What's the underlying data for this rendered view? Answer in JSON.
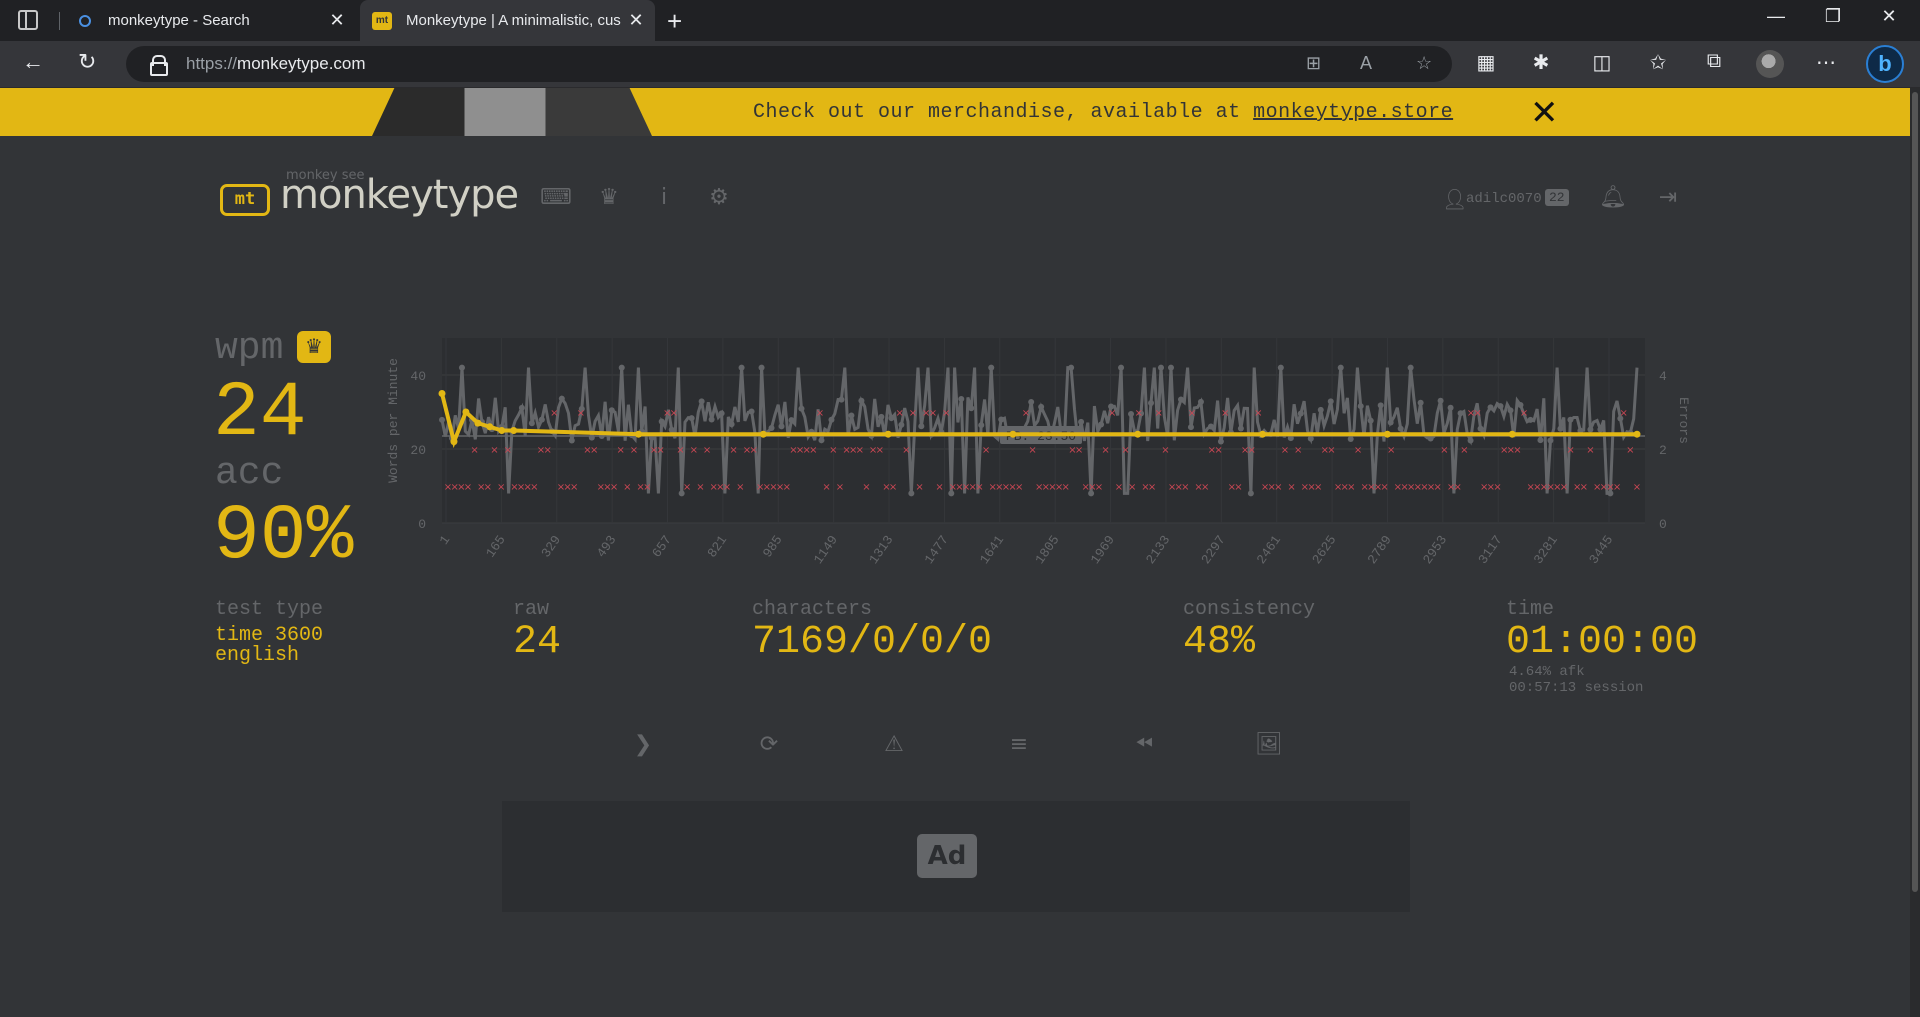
{
  "browser": {
    "tabs": [
      {
        "title": "monkeytype - Search",
        "icon": "search-icon"
      },
      {
        "title": "Monkeytype | A minimalistic, cus",
        "icon": "monkeytype-favicon"
      }
    ],
    "url_protocol": "https://",
    "url_host": "monkeytype.com"
  },
  "banner": {
    "text": "Check out our merchandise, available at ",
    "link": "monkeytype.store"
  },
  "header": {
    "logo_small": "monkey see",
    "logo_text": "monkeytype",
    "logo_icon": "mt",
    "username": "adilc0070",
    "level": "22"
  },
  "result": {
    "wpm_label": "wpm",
    "wpm": "24",
    "acc_label": "acc",
    "acc": "90%",
    "test_type_label": "test type",
    "test_type_line1": "time 3600",
    "test_type_line2": "english",
    "raw_label": "raw",
    "raw": "24",
    "characters_label": "characters",
    "characters": "7169/0/0/0",
    "consistency_label": "consistency",
    "consistency": "48%",
    "time_label": "time",
    "time": "01:00:00",
    "afk": "4.64% afk",
    "session": "00:57:13 session"
  },
  "chart_data": {
    "type": "line",
    "ylabel": "Words per Minute",
    "y2label": "Errors",
    "ylim": [
      0,
      50
    ],
    "y2lim": [
      0,
      5
    ],
    "yticks": [
      0,
      20,
      40
    ],
    "y2ticks": [
      0,
      2,
      4
    ],
    "xticks": [
      "1",
      "165",
      "329",
      "493",
      "657",
      "821",
      "985",
      "1149",
      "1313",
      "1477",
      "1641",
      "1805",
      "1969",
      "2133",
      "2297",
      "2461",
      "2625",
      "2789",
      "2953",
      "3117",
      "3281",
      "3445"
    ],
    "pb_label": "PB: 23.50",
    "pb_value": 23.5,
    "series": [
      {
        "name": "wpm",
        "color": "#e2b714",
        "approx_values": [
          35,
          22,
          30,
          27,
          26,
          25,
          25,
          24,
          24,
          24,
          24,
          24,
          24,
          24,
          24,
          24
        ]
      },
      {
        "name": "raw",
        "color": "#646669",
        "approx_range": [
          5,
          45
        ]
      },
      {
        "name": "errors",
        "color": "#ca4754",
        "approx_levels": [
          1,
          2,
          3
        ]
      }
    ]
  },
  "colors": {
    "bg": "#323437",
    "main": "#e2b714",
    "sub": "#646669",
    "text": "#d1d0c5",
    "error": "#ca4754"
  },
  "ad": {
    "label": "Ad"
  }
}
